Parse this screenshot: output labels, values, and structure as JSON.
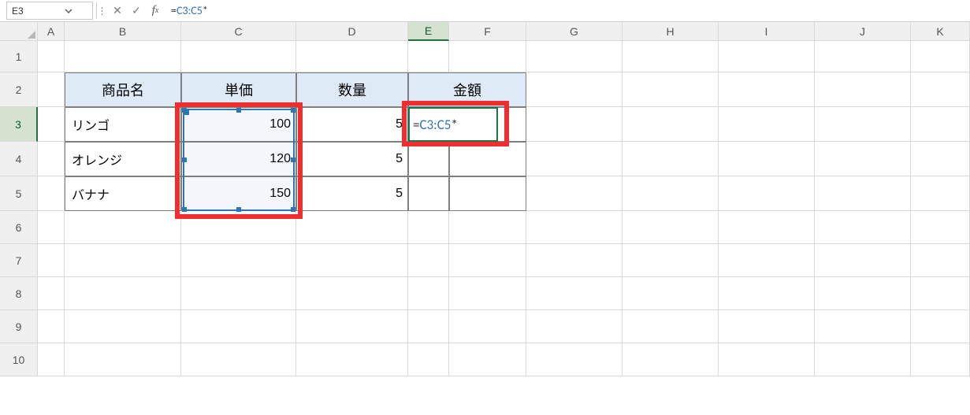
{
  "name_box": {
    "value": "E3"
  },
  "formula_bar": {
    "prefix": "=",
    "ref": "C3:C5",
    "suffix": "*"
  },
  "columns": [
    "A",
    "B",
    "C",
    "D",
    "E",
    "F",
    "G",
    "H",
    "I",
    "J",
    "K"
  ],
  "rows": [
    "1",
    "2",
    "3",
    "4",
    "5",
    "6",
    "7",
    "8",
    "9",
    "10"
  ],
  "table": {
    "headers": {
      "b2": "商品名",
      "c2": "単価",
      "d2": "数量",
      "ef2": "金額"
    },
    "rows": [
      {
        "name": "リンゴ",
        "price": "100",
        "qty": "5"
      },
      {
        "name": "オレンジ",
        "price": "120",
        "qty": "5"
      },
      {
        "name": "バナナ",
        "price": "150",
        "qty": "5"
      }
    ]
  },
  "editing_cell": {
    "prefix": "=",
    "ref": "C3:C5",
    "suffix": "*"
  },
  "icons": {
    "dots": "⋮",
    "x": "✕",
    "check": "✓",
    "fx_f": "f",
    "fx_x": "x"
  }
}
